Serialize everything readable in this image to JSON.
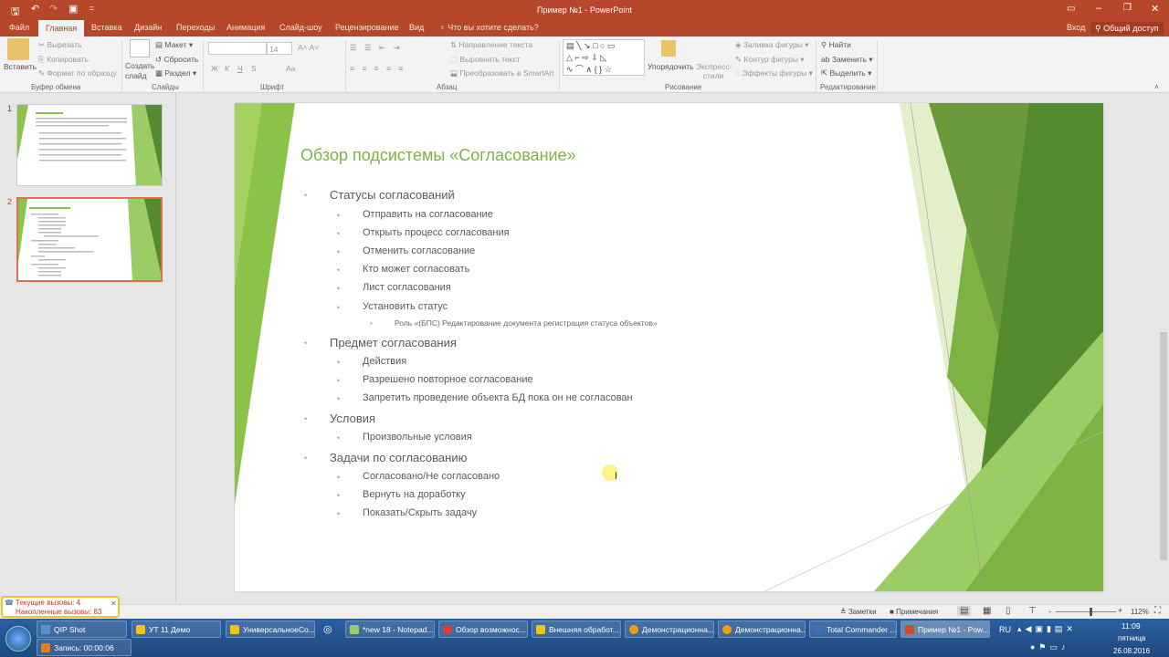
{
  "window": {
    "title": "Пример №1 - PowerPoint",
    "qat_more": "="
  },
  "tabs": [
    "Файл",
    "Главная",
    "Вставка",
    "Дизайн",
    "Переходы",
    "Анимация",
    "Слайд-шоу",
    "Рецензирование",
    "Вид"
  ],
  "tell_me": "Что вы хотите сделать?",
  "account": {
    "signin": "Вход",
    "share": "Общий доступ"
  },
  "ribbon": {
    "clipboard": {
      "paste": "Вставить",
      "cut": "Вырезать",
      "copy": "Копировать",
      "format_painter": "Формат по образцу",
      "label": "Буфер обмена"
    },
    "slides": {
      "new_slide": "Создать слайд",
      "layout": "Макет",
      "reset": "Сбросить",
      "section": "Раздел",
      "label": "Слайды"
    },
    "font": {
      "font_name": "",
      "font_size": "14",
      "bold": "Ж",
      "italic": "К",
      "underline": "Ч",
      "strike": "S",
      "case": "Aa",
      "label": "Шрифт"
    },
    "paragraph": {
      "text_direction": "Направление текста",
      "align_text": "Выровнять текст",
      "smartart": "Преобразовать в SmartArt",
      "label": "Абзац"
    },
    "drawing": {
      "arrange": "Упорядочить",
      "quick_styles": "Экспресс-стили",
      "fill": "Заливка фигуры",
      "outline": "Контур фигуры",
      "effects": "Эффекты фигуры",
      "label": "Рисование"
    },
    "editing": {
      "find": "Найти",
      "replace": "Заменить",
      "select": "Выделить",
      "label": "Редактирование"
    }
  },
  "thumbnails": [
    {
      "number": "1"
    },
    {
      "number": "2"
    }
  ],
  "slide": {
    "title": "Обзор подсистемы «Согласование»",
    "sections": [
      {
        "text": "Статусы согласований",
        "items": [
          "Отправить на согласование",
          "Открыть процесс согласования",
          "Отменить согласование",
          "Кто может согласовать",
          "Лист согласования",
          "Установить статус"
        ],
        "sub": "Роль «(БПС) Редактирование документа регистрация статуса объектов»"
      },
      {
        "text": "Предмет согласования",
        "items": [
          "Действия",
          "Разрешено повторное согласование",
          "Запретить проведение объекта БД пока он не согласован"
        ]
      },
      {
        "text": "Условия",
        "items": [
          "Произвольные условия"
        ]
      },
      {
        "text": "Задачи по согласованию",
        "items": [
          "Согласовано/Не согласовано",
          "Вернуть на доработку",
          "Показать/Скрыть задачу"
        ]
      }
    ]
  },
  "notification": {
    "current": "Текущие вызовы: 4",
    "accumulated": "Накопленные вызовы: 83"
  },
  "statusbar": {
    "notes": "Заметки",
    "comments": "Примечания",
    "zoom": "112%",
    "zoom_level": 0.56
  },
  "taskbar": {
    "buttons": [
      "QIP Shot",
      "УТ 11 Демо",
      "УниверсальноеСо...",
      "*new 18 - Notepad...",
      "Обзор возможнос...",
      "Внешняя обработ...",
      "Демонстрационна...",
      "Демонстрационна...",
      "Total Commander ...",
      "Пример №1 - Pow..."
    ],
    "record": "Запись: 00:00:06",
    "lang": "RU",
    "time": "11:09",
    "day": "пятница",
    "date": "26.08.2016"
  },
  "colors": {
    "accent": "#b7472a",
    "green": "#8bc34a",
    "title_green": "#7cb342"
  }
}
